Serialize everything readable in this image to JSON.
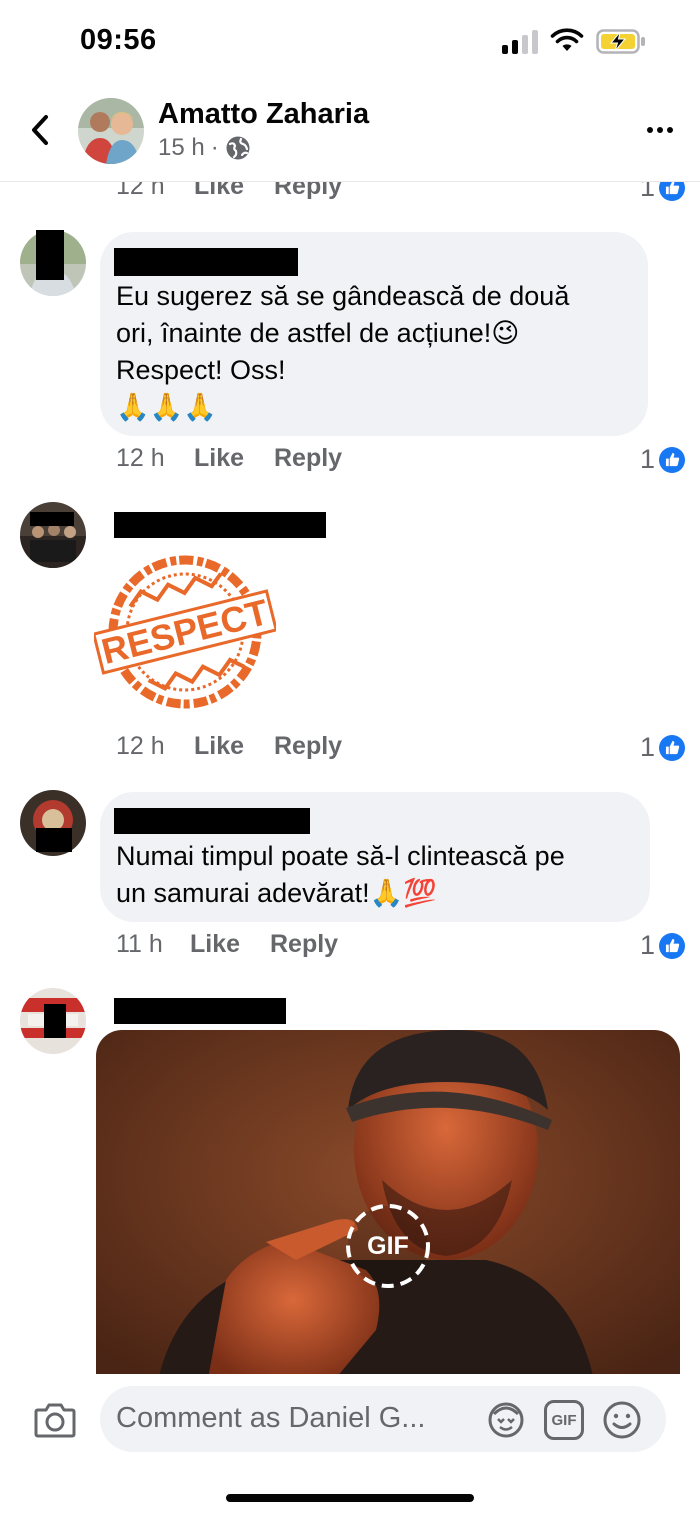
{
  "status_bar": {
    "time": "09:56"
  },
  "header": {
    "name": "Amatto Zaharia",
    "age": "15 h",
    "separator": "·"
  },
  "comments": [
    {
      "time": "12 h",
      "like": "Like",
      "reply": "Reply",
      "reactions": "1"
    },
    {
      "lines": [
        "Eu sugerez să se gândească de două",
        "ori, înainte de astfel de  acțiune!",
        "Respect! Oss!"
      ],
      "emoji_line1": "😉",
      "emoji_line2": "🙏🙏🙏",
      "time": "12 h",
      "like": "Like",
      "reply": "Reply",
      "reactions": "1"
    },
    {
      "sticker_text": "RESPECT",
      "time": "12 h",
      "like": "Like",
      "reply": "Reply",
      "reactions": "1"
    },
    {
      "lines": [
        "Numai timpul poate să-l clintească pe",
        "un samurai adevărat!"
      ],
      "emoji": "🙏💯",
      "time": "11 h",
      "like": "Like",
      "reply": "Reply",
      "reactions": "1"
    },
    {
      "gif_label": "GIF"
    }
  ],
  "composer": {
    "placeholder": "Comment as Daniel G...",
    "gif_label": "GIF"
  },
  "colors": {
    "accent": "#1877f2",
    "bubble": "#f0f2f5",
    "muted": "#65676b",
    "sticker": "#e8692a"
  }
}
